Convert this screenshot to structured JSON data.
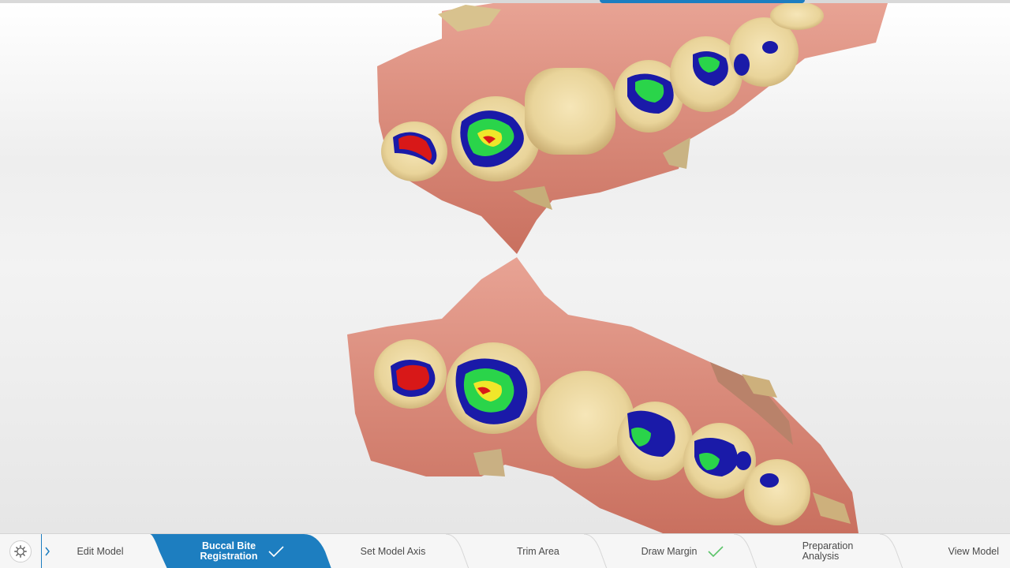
{
  "workflow": {
    "steps": [
      {
        "label": "Edit Model",
        "state": "normal"
      },
      {
        "label": "Buccal Bite\nRegistration",
        "state": "active",
        "done": true
      },
      {
        "label": "Set Model Axis",
        "state": "normal"
      },
      {
        "label": "Trim Area",
        "state": "normal"
      },
      {
        "label": "Draw Margin",
        "state": "normal",
        "done": true
      },
      {
        "label": "Preparation\nAnalysis",
        "state": "normal"
      },
      {
        "label": "View Model",
        "state": "normal"
      }
    ],
    "icons": {
      "settings": "gear-icon",
      "expand": "chevron-right-icon",
      "done": "checkmark-icon"
    },
    "colors": {
      "accent": "#1d7ec0",
      "done_check_active": "#ffffff",
      "done_check": "#5cc46a"
    }
  },
  "viewport": {
    "content": "3D dental scan: upper and lower jaw models with occlusal contact heatmap",
    "heatmap_colors": [
      "#1a1aa8",
      "#2ad44a",
      "#f0e62a",
      "#d81818"
    ]
  }
}
